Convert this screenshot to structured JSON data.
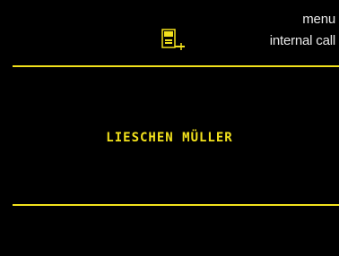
{
  "softkeys": {
    "menu_label": "menu",
    "internal_call_label": "internal call"
  },
  "status": {
    "icon": "handset-line-icon"
  },
  "display": {
    "caller_name": "LIESCHEN MÜLLER"
  },
  "colors": {
    "accent": "#f2e11c",
    "softkey_text": "#e9e9e9",
    "background": "#000000"
  }
}
